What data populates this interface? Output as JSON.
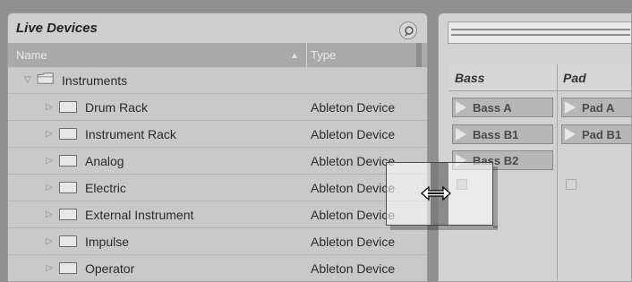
{
  "browser": {
    "title": "Live Devices",
    "columns": {
      "name": "Name",
      "type": "Type",
      "sort_icon": "sort-ascending-icon"
    },
    "root_folder": {
      "label": "Instruments",
      "icon": "folder-open-icon"
    },
    "items": [
      {
        "label": "Drum Rack",
        "type": "Ableton Device"
      },
      {
        "label": "Instrument Rack",
        "type": "Ableton Device"
      },
      {
        "label": "Analog",
        "type": "Ableton Device"
      },
      {
        "label": "Electric",
        "type": "Ableton Device"
      },
      {
        "label": "External Instrument",
        "type": "Ableton Device"
      },
      {
        "label": "Impulse",
        "type": "Ableton Device"
      },
      {
        "label": "Operator",
        "type": "Ableton Device"
      }
    ]
  },
  "session": {
    "tracks": [
      {
        "name": "Bass",
        "clips": [
          "Bass A",
          "Bass B1",
          "Bass B2"
        ]
      },
      {
        "name": "Pad",
        "clips": [
          "Pad A",
          "Pad B1"
        ]
      }
    ]
  },
  "drag": {
    "cursor_icon": "horizontal-resize-cursor-icon"
  },
  "colors": {
    "panel": "#c9c9c9",
    "header": "#a9a9a9",
    "clip": "#b7b7b7",
    "background": "#8f8f8f"
  }
}
